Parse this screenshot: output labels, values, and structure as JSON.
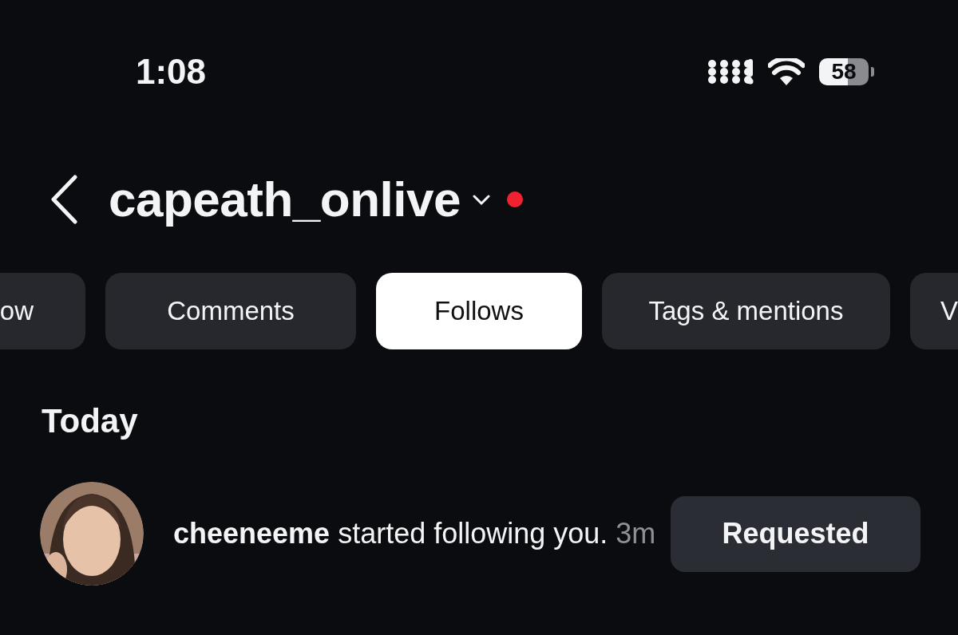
{
  "status_bar": {
    "time": "1:08",
    "battery": "58"
  },
  "header": {
    "title": "capeath_onlive",
    "live": true
  },
  "tabs": [
    {
      "label": "ow",
      "selected": false
    },
    {
      "label": "Comments",
      "selected": false
    },
    {
      "label": "Follows",
      "selected": true
    },
    {
      "label": "Tags & mentions",
      "selected": false
    },
    {
      "label": "V",
      "selected": false
    }
  ],
  "section": "Today",
  "notifications": [
    {
      "text": "**cheeneeme** started following you.",
      "time": "3m",
      "button": "Requested"
    }
  ]
}
